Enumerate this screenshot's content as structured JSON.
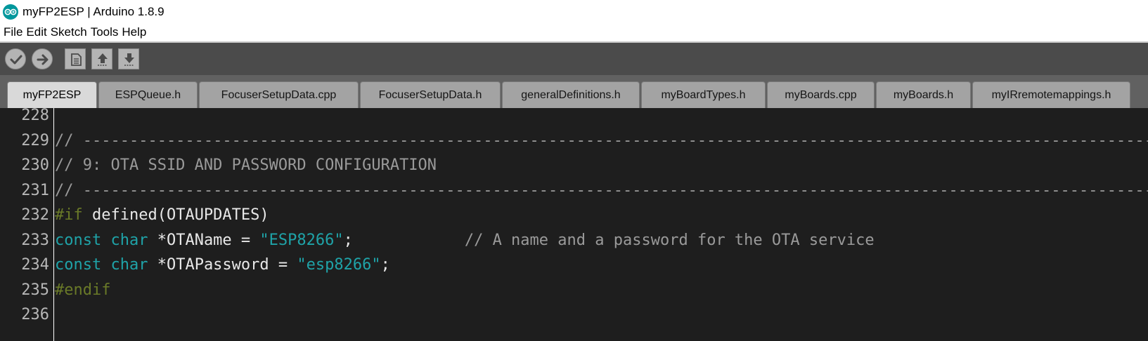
{
  "window": {
    "title": "myFP2ESP | Arduino 1.8.9",
    "app_icon": "arduino-logo-icon"
  },
  "menu": {
    "items": [
      "File",
      "Edit",
      "Sketch",
      "Tools",
      "Help"
    ]
  },
  "toolbar": {
    "buttons": [
      {
        "name": "verify",
        "icon": "checkmark-icon"
      },
      {
        "name": "upload",
        "icon": "arrow-right-icon"
      },
      {
        "name": "new",
        "icon": "new-file-icon"
      },
      {
        "name": "open",
        "icon": "arrow-up-icon"
      },
      {
        "name": "save",
        "icon": "arrow-down-icon"
      }
    ]
  },
  "tabs": [
    {
      "label": "myFP2ESP",
      "active": true
    },
    {
      "label": "ESPQueue.h",
      "active": false
    },
    {
      "label": "FocuserSetupData.cpp",
      "active": false
    },
    {
      "label": "FocuserSetupData.h",
      "active": false
    },
    {
      "label": "generalDefinitions.h",
      "active": false
    },
    {
      "label": "myBoardTypes.h",
      "active": false
    },
    {
      "label": "myBoards.cpp",
      "active": false
    },
    {
      "label": "myBoards.h",
      "active": false
    },
    {
      "label": "myIRremotemappings.h",
      "active": false
    }
  ],
  "editor": {
    "lines": [
      {
        "no": "228",
        "tokens": []
      },
      {
        "no": "229",
        "tokens": [
          {
            "t": "comment",
            "v": "// ------------------------------------------------------------------------------------------------------------------------------------------"
          }
        ]
      },
      {
        "no": "230",
        "tokens": [
          {
            "t": "comment",
            "v": "// 9: OTA SSID AND PASSWORD CONFIGURATION"
          }
        ]
      },
      {
        "no": "231",
        "tokens": [
          {
            "t": "comment",
            "v": "// ------------------------------------------------------------------------------------------------------------------------------------------"
          }
        ]
      },
      {
        "no": "232",
        "tokens": [
          {
            "t": "preproc",
            "v": "#if"
          },
          {
            "t": "plain",
            "v": " defined(OTAUPDATES)"
          }
        ]
      },
      {
        "no": "233",
        "tokens": [
          {
            "t": "keyword",
            "v": "const"
          },
          {
            "t": "plain",
            "v": " "
          },
          {
            "t": "keyword",
            "v": "char"
          },
          {
            "t": "plain",
            "v": " *OTAName = "
          },
          {
            "t": "string",
            "v": "\"ESP8266\""
          },
          {
            "t": "plain",
            "v": ";            "
          },
          {
            "t": "comment",
            "v": "// A name and a password for the OTA service"
          }
        ]
      },
      {
        "no": "234",
        "tokens": [
          {
            "t": "keyword",
            "v": "const"
          },
          {
            "t": "plain",
            "v": " "
          },
          {
            "t": "keyword",
            "v": "char"
          },
          {
            "t": "plain",
            "v": " *OTAPassword = "
          },
          {
            "t": "string",
            "v": "\"esp8266\""
          },
          {
            "t": "plain",
            "v": ";"
          }
        ]
      },
      {
        "no": "235",
        "tokens": [
          {
            "t": "preproc",
            "v": "#endif"
          }
        ]
      },
      {
        "no": "236",
        "tokens": []
      }
    ]
  },
  "colors": {
    "accent": "#00979c",
    "toolbar_bg": "#4b4b4b",
    "tabs_bg": "#616161",
    "editor_bg": "#1e1e1e"
  }
}
